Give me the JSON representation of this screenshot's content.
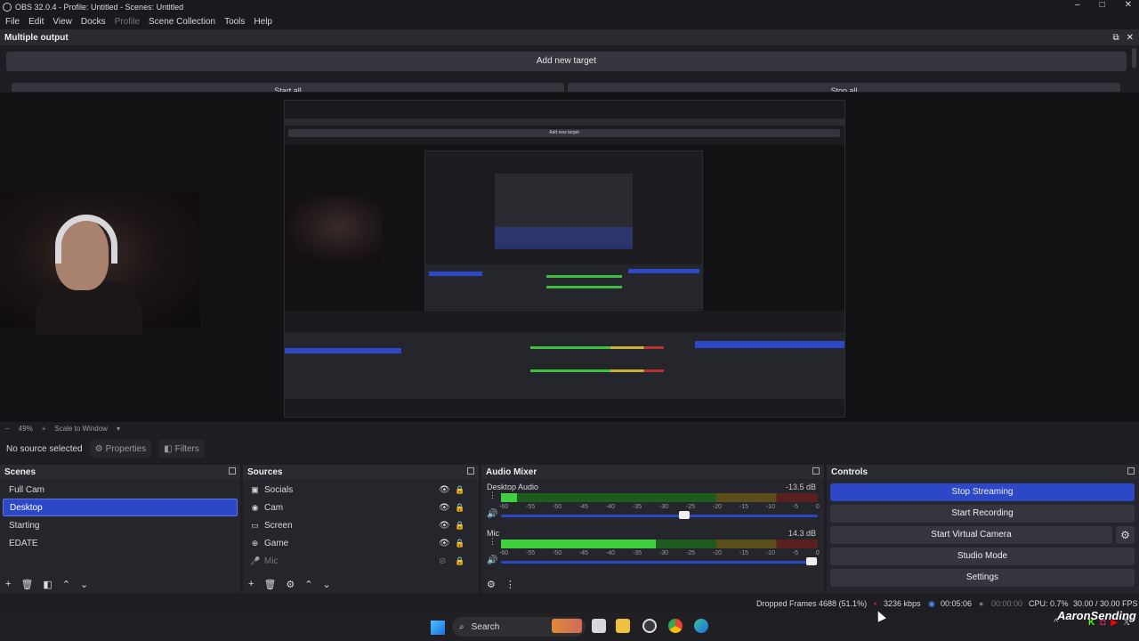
{
  "window": {
    "title": "OBS 32.0.4 - Profile: Untitled - Scenes: Untitled",
    "controls": [
      "–",
      "□",
      "✕"
    ]
  },
  "menu": [
    "File",
    "Edit",
    "View",
    "Docks",
    "Profile",
    "Scene Collection",
    "Tools",
    "Help"
  ],
  "multiple_output": {
    "title": "Multiple output",
    "add_target": "Add new target",
    "start_all": "Start all",
    "stop_all": "Stop all"
  },
  "preview": {
    "zoom": "49%",
    "scale_mode": "Scale to Window",
    "nested_add_target": "Add new target"
  },
  "source_bar": {
    "status": "No source selected",
    "properties": "Properties",
    "filters": "Filters"
  },
  "scenes": {
    "title": "Scenes",
    "items": [
      "Full Cam",
      "Desktop",
      "Starting",
      "EDATE"
    ],
    "selected_index": 1
  },
  "sources": {
    "title": "Sources",
    "items": [
      {
        "name": "Socials",
        "icon": "image-icon",
        "visible": true,
        "locked": true
      },
      {
        "name": "Cam",
        "icon": "camera-icon",
        "visible": true,
        "locked": true
      },
      {
        "name": "Screen",
        "icon": "monitor-icon",
        "visible": true,
        "locked": true
      },
      {
        "name": "Game",
        "icon": "gamepad-icon",
        "visible": true,
        "locked": true
      },
      {
        "name": "Mic",
        "icon": "mic-icon",
        "visible": false,
        "locked": true
      }
    ]
  },
  "audio_mixer": {
    "title": "Audio Mixer",
    "channels": [
      {
        "name": "Desktop Audio",
        "db": "-13.5 dB",
        "level": 0.05,
        "fader": 0.58
      },
      {
        "name": "Mic",
        "db": "14.3 dB",
        "level": 0.49,
        "fader": 0.98
      }
    ],
    "scale": [
      "-60",
      "-55",
      "-50",
      "-45",
      "-40",
      "-35",
      "-30",
      "-25",
      "-20",
      "-15",
      "-10",
      "-5",
      "0"
    ]
  },
  "controls": {
    "title": "Controls",
    "stop_streaming": "Stop Streaming",
    "start_recording": "Start Recording",
    "start_virtual_camera": "Start Virtual Camera",
    "studio_mode": "Studio Mode",
    "settings": "Settings"
  },
  "status": {
    "dropped_frames": "Dropped Frames 4688 (51.1%)",
    "bitrate": "3236 kbps",
    "stream_time": "00:05:06",
    "record_time": "00:00:00",
    "cpu": "CPU: 0.7%",
    "fps": "30.00 / 30.00 FPS"
  },
  "taskbar": {
    "search": "Search",
    "overlay_name": "AaronSending"
  },
  "colors": {
    "accent": "#2c48c6",
    "meter_green": "#3fcf3f"
  }
}
